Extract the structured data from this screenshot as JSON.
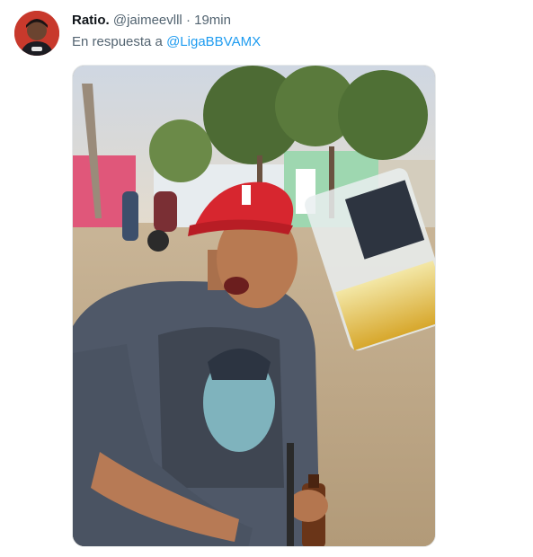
{
  "tweet": {
    "display_name": "Ratio.",
    "handle": "@jaimeevlll",
    "separator": "·",
    "time": "19min",
    "reply_prefix": "En respuesta a",
    "reply_mention": "@LigaBBVAMX",
    "media": {
      "alt_description": "Photo of a young man in a red cap laughing outdoors holding a beer bottle while a glass of beer is raised toward the camera"
    }
  },
  "colors": {
    "text_primary": "#0f1419",
    "text_secondary": "#536471",
    "link": "#1d9bf0",
    "media_border": "#e6e9ea"
  },
  "icons": {
    "avatar": "profile-avatar-image"
  }
}
